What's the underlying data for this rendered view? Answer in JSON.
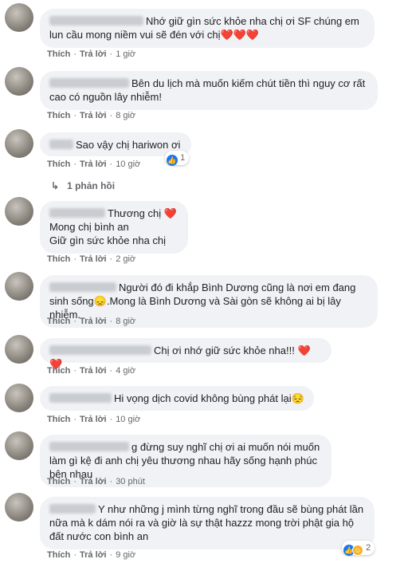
{
  "actions": {
    "like": "Thích",
    "reply": "Trả lời",
    "separator": "·"
  },
  "comments": [
    {
      "text": "Nhớ giữ gìn sức khỏe nha chị ơi SF chúng em lun cầu mong niềm vui sẽ đén với chị",
      "hearts": "❤️❤️❤️",
      "time": "1 giờ"
    },
    {
      "text": "Bên du lịch mà muốn kiếm chút tiền thì nguy cơ rất cao có nguồn lây nhiễm!",
      "time": "8 giờ"
    },
    {
      "text": "Sao vậy chị hariwon ơi",
      "time": "10 giờ",
      "reaction_count": "1"
    },
    {
      "text": "Thương chị",
      "hearts": "❤️",
      "line2": "Mong chị bình an",
      "line3": "Giữ gìn sức khỏe nha chị",
      "time": "2 giờ"
    },
    {
      "text": "Người đó đi khắp Bình Dương cũng là nơi em đang sinh sống",
      "emoji": "😞",
      "text2": ".Mong là Bình Dương và Sài gòn sẽ không ai bị lây nhiễm.",
      "time": "8 giờ"
    },
    {
      "text": "Chị ơi nhớ giữ sức khỏe nha!!!",
      "hearts": "❤️❤️",
      "time": "4 giờ"
    },
    {
      "text": "Hi vọng dịch covid không bùng phát lại",
      "emoji": "😔",
      "time": "10 giờ"
    },
    {
      "text": "g đừng suy nghĩ chị ơi ai muốn nói muốn làm gì kệ đi anh chị yêu thương nhau hãy sống hạnh phúc bên nhau",
      "time": "30 phút"
    },
    {
      "text": "Y như những j mình từng nghĩ trong đầu sẽ bùng phát lần nữa mà k dám nói ra và giờ là sự thật hazzz mong trời phật gia hộ đất nước con bình an",
      "time": "9 giờ",
      "reaction_count": "2"
    }
  ],
  "reply_link": "1 phản hồi",
  "icons": {
    "like": "like-icon",
    "care": "care-icon",
    "reply_arrow": "reply-arrow-icon"
  },
  "colors": {
    "bubble": "#f0f2f5",
    "meta": "#65676b",
    "like_blue": "#1877f2",
    "heart": "#e41e3f"
  }
}
